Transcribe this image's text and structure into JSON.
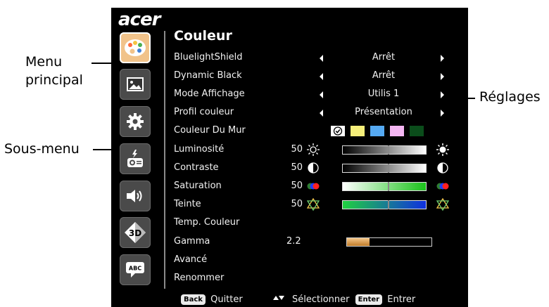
{
  "callouts": {
    "menu_principal": [
      "Menu",
      "principal"
    ],
    "sous_menu": "Sous-menu",
    "reglages": "Réglages"
  },
  "osd": {
    "logo": "acer",
    "title": "Couleur",
    "nav_icons": [
      "palette-icon",
      "image-icon",
      "gear-icon",
      "projector-icon",
      "speaker-icon",
      "3d-icon",
      "abc-speech-icon"
    ],
    "rows": {
      "bluelight": {
        "label": "BluelightShield",
        "value": "Arrêt"
      },
      "dynamic_black": {
        "label": "Dynamic Black",
        "value": "Arrêt"
      },
      "mode_affichage": {
        "label": "Mode Affichage",
        "value": "Utilis 1"
      },
      "profil_couleur": {
        "label": "Profil couleur",
        "value": "Présentation"
      },
      "couleur_mur": {
        "label": "Couleur Du Mur",
        "swatches": [
          "#ffffff",
          "#f5ef7a",
          "#55a9f2",
          "#f4b6f2",
          "#0b4d1b"
        ],
        "selected": 0
      },
      "luminosite": {
        "label": "Luminosité",
        "value": "50",
        "level": 0.5
      },
      "contraste": {
        "label": "Contraste",
        "value": "50",
        "level": 0.5
      },
      "saturation": {
        "label": "Saturation",
        "value": "50",
        "level": 0.5
      },
      "teinte": {
        "label": "Teinte",
        "value": "50",
        "level": 0.5
      },
      "temp_couleur": {
        "label": "Temp. Couleur"
      },
      "gamma": {
        "label": "Gamma",
        "value": "2.2",
        "level": 0.27
      },
      "avance": {
        "label": "Avancé"
      },
      "renommer": {
        "label": "Renommer"
      }
    },
    "footer": {
      "back_key": "Back",
      "quit": "Quitter",
      "select": "Sélectionner",
      "enter_key": "Enter",
      "enter": "Entrer"
    }
  },
  "colors": {
    "background": "#000000",
    "active_icon": "#f1c38a",
    "text": "#f2f2f2"
  }
}
